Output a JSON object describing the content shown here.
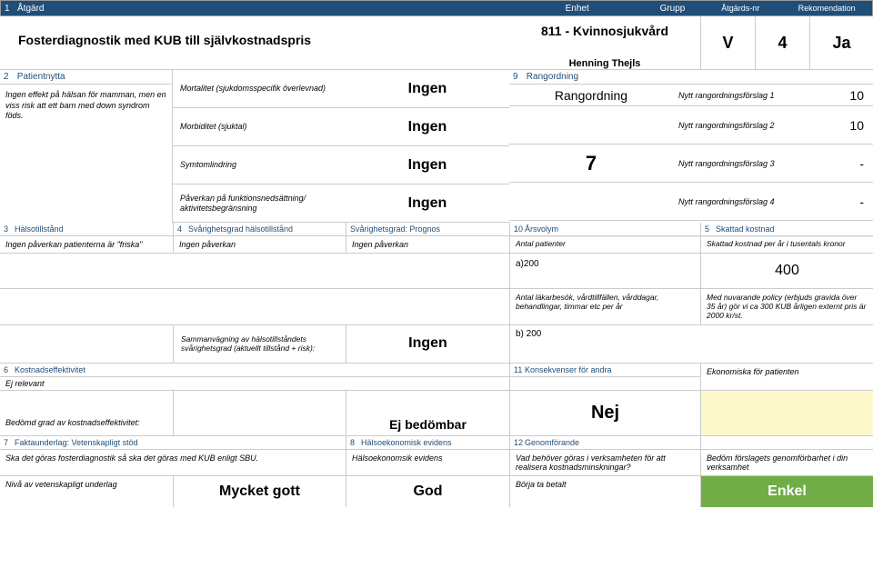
{
  "header": {
    "num": "1",
    "atgard": "Åtgärd",
    "enhet": "Enhet",
    "grupp": "Grupp",
    "atgnr": "Åtgärds-nr",
    "rek": "Rekomendation"
  },
  "row1": {
    "title": "Fosterdiagnostik med KUB till självkostnadspris",
    "unit": "811 - Kvinnosjukvård",
    "author": "Henning Thejls",
    "grupp": "V",
    "nr": "4",
    "rek": "Ja"
  },
  "sec2": {
    "head_num": "2",
    "head": "Patientnytta",
    "body": "Ingen effekt på hälsan för mamman, men en viss risk att ett barn med down syndrom föds."
  },
  "params": {
    "mort_l": "Mortalitet (sjukdomsspecifik överlevnad)",
    "mort_v": "Ingen",
    "morb_l": "Morbiditet (sjuktal)",
    "morb_v": "Ingen",
    "sym_l": "Symtomlindring",
    "sym_v": "Ingen",
    "pov_l": "Påverkan på funktionsnedsättning/ aktivitetsbegränsning",
    "pov_v": "Ingen"
  },
  "sec9": {
    "head_num": "9",
    "head": "Rangordning",
    "main": "Rangordning",
    "seven": "7",
    "r1l": "Nytt rangordningsförslag 1",
    "r1v": "10",
    "r2l": "Nytt rangordningsförslag 2",
    "r2v": "10",
    "r3l": "Nytt rangordningsförslag 3",
    "r3v": "-",
    "r4l": "Nytt rangordningsförslag 4",
    "r4v": "-"
  },
  "sec3": {
    "c1h_num": "3",
    "c1h": "Hälsotillstånd",
    "c1b": "Ingen påverkan patienterna är \"friska\"",
    "c2h_num": "4",
    "c2h": "Svårighetsgrad hälsotillstånd",
    "c2b": "Ingen påverkan",
    "c3h": "Svårighetsgrad: Prognos",
    "c3b": "Ingen påverkan",
    "c4h_num": "10",
    "c4h": "Årsvolym",
    "c4s": "Antal patienter",
    "c5h_num": "5",
    "c5h": "Skattad kostnad",
    "c5s": "Skattad kostnad per år i tusentals kronor"
  },
  "a200": {
    "label": "a)200",
    "val": "400"
  },
  "lak": {
    "mid": "Antal läkarbesök, vårdtillfällen, vårddagar, behandlingar, timmar etc per år",
    "right": "Med nuvarande policy (erbjuds gravida över 35 år) gör vi ca 300 KUB årligen externt pris är 2000 kr/st."
  },
  "samm": {
    "label": "Sammanvägning av hälsotillståndets svårighetsgrad (aktuellt tillstånd + risk):",
    "val": "Ingen",
    "b200": "b) 200"
  },
  "kost": {
    "h1_num": "6",
    "h1": "Kostnadseffektivitet",
    "b1": "Ej relevant",
    "h2_num": "11",
    "h2": "Konsekvenser för andra",
    "r": "Ekonomiska för patienten"
  },
  "nej": {
    "bed": "Bedömd grad av kostnadseffektivitet:",
    "ejb": "Ej bedömbar",
    "nej": "Nej"
  },
  "fakta": {
    "h1_num": "7",
    "h1": "Faktaunderlag: Vetenskapligt stöd",
    "b1": "Ska det göras fosterdiagnostik så ska det göras med KUB enligt SBU.",
    "h2_num": "8",
    "h2": "Hälsoekonomisk evidens",
    "b2": "Hälsoekonomsik evidens",
    "h3_num": "12",
    "h3": "Genomförande",
    "b3": "Vad behöver göras i verksamheten för att realisera kostnadsminskningar?",
    "b4": "Bedöm förslagets genomförbarhet i din verksamhet"
  },
  "final": {
    "niv": "Nivå av vetenskapligt underlag",
    "mg": "Mycket gott",
    "god": "God",
    "borja": "Börja ta betalt",
    "enkel": "Enkel"
  }
}
